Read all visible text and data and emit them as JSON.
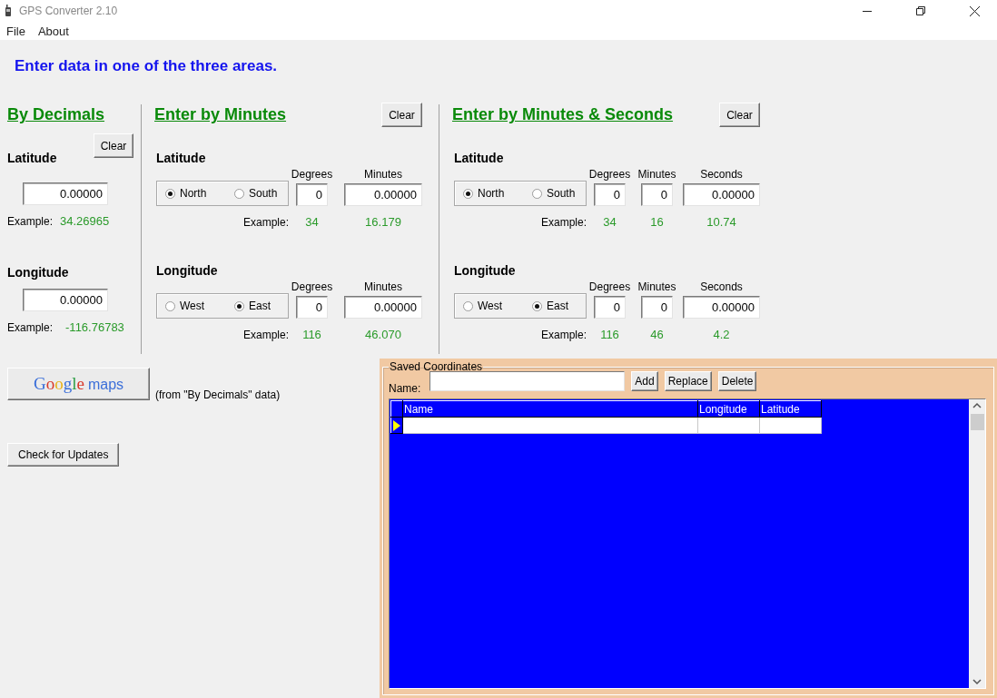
{
  "window": {
    "title": "GPS Converter 2.10"
  },
  "menu": [
    {
      "label": "File"
    },
    {
      "label": "About"
    }
  ],
  "instruction": "Enter data in one of the three areas.",
  "decimals": {
    "title": "By Decimals",
    "clear": "Clear",
    "coordinates": [
      {
        "label": "Latitude",
        "value": "0.00000",
        "example_label": "Example:",
        "example": "34.26965"
      },
      {
        "label": "Longitude",
        "value": "0.00000",
        "example_label": "Example:",
        "example": "-116.76783"
      }
    ]
  },
  "minutes": {
    "title": "Enter by Minutes",
    "clear": "Clear",
    "coordinates": [
      {
        "label": "Latitude",
        "options": [
          {
            "label": "North",
            "selected": true
          },
          {
            "label": "South",
            "selected": false
          }
        ],
        "example_label": "Example:",
        "fields": [
          {
            "header": "Degrees",
            "value": "0",
            "example": "34"
          },
          {
            "header": "Minutes",
            "value": "0.00000",
            "example": "16.179"
          }
        ]
      },
      {
        "label": "Longitude",
        "options": [
          {
            "label": "West",
            "selected": false
          },
          {
            "label": "East",
            "selected": true
          }
        ],
        "example_label": "Example:",
        "fields": [
          {
            "header": "Degrees",
            "value": "0",
            "example": "116"
          },
          {
            "header": "Minutes",
            "value": "0.00000",
            "example": "46.070"
          }
        ]
      }
    ]
  },
  "minutes_seconds": {
    "title": "Enter by Minutes & Seconds",
    "clear": "Clear",
    "coordinates": [
      {
        "label": "Latitude",
        "options": [
          {
            "label": "North",
            "selected": true
          },
          {
            "label": "South",
            "selected": false
          }
        ],
        "example_label": "Example:",
        "fields": [
          {
            "header": "Degrees",
            "value": "0",
            "example": "34"
          },
          {
            "header": "Minutes",
            "value": "0",
            "example": "16"
          },
          {
            "header": "Seconds",
            "value": "0.00000",
            "example": "10.74"
          }
        ]
      },
      {
        "label": "Longitude",
        "options": [
          {
            "label": "West",
            "selected": false
          },
          {
            "label": "East",
            "selected": true
          }
        ],
        "example_label": "Example:",
        "fields": [
          {
            "header": "Degrees",
            "value": "0",
            "example": "116"
          },
          {
            "header": "Minutes",
            "value": "0",
            "example": "46"
          },
          {
            "header": "Seconds",
            "value": "0.00000",
            "example": "4.2"
          }
        ]
      }
    ]
  },
  "map_button": {
    "logo": "Google",
    "label": "maps",
    "note": "(from \"By Decimals\" data)"
  },
  "update_button": "Check for Updates",
  "saved": {
    "title": "Saved Coordinates",
    "name_label": "Name:",
    "buttons": [
      "Add",
      "Replace",
      "Delete"
    ],
    "columns": [
      "Name",
      "Longitude",
      "Latitude"
    ]
  }
}
